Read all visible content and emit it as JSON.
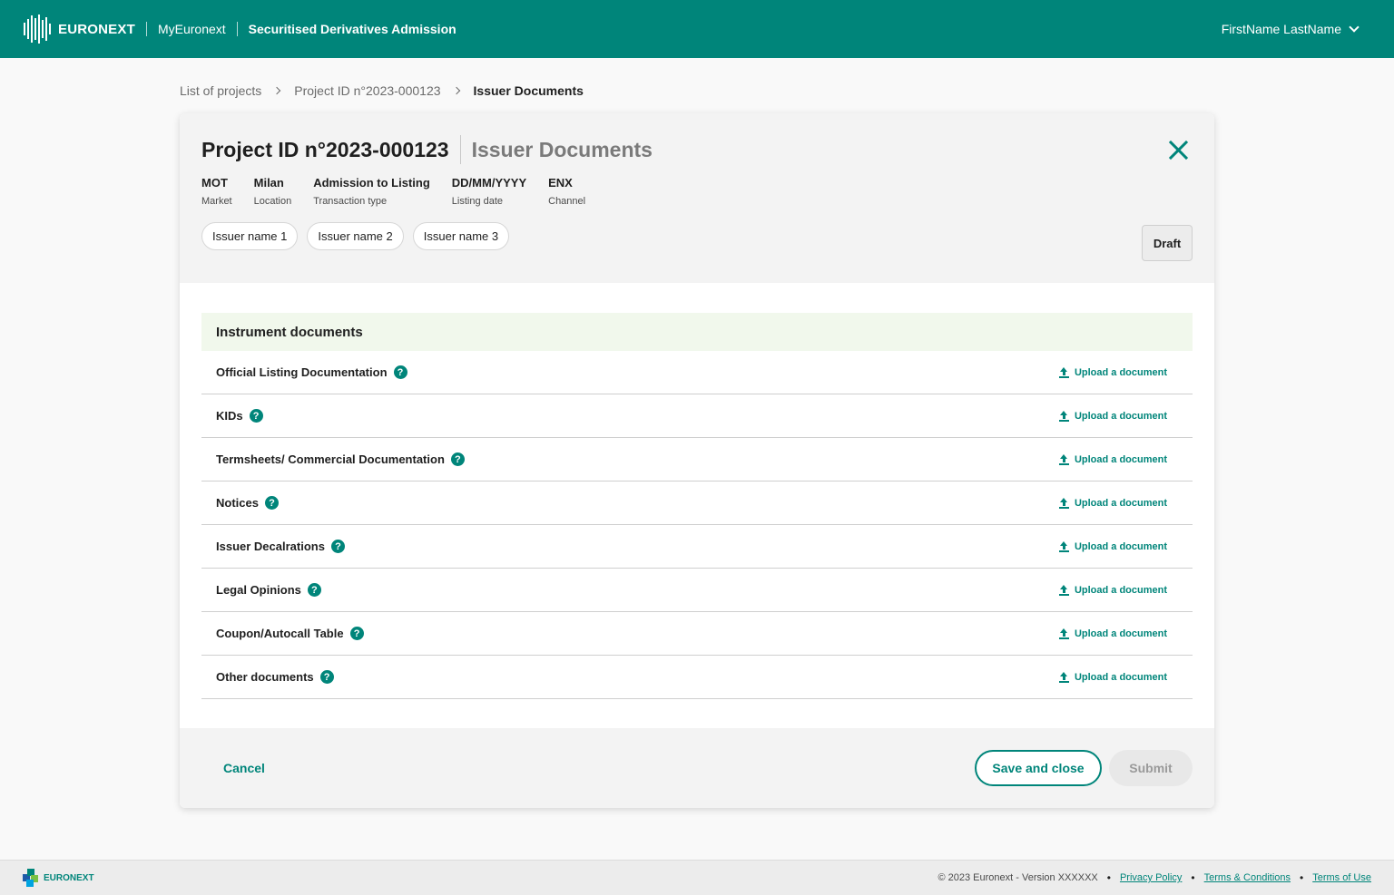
{
  "header": {
    "brand": "EURONEXT",
    "app": "MyEuronext",
    "title": "Securitised Derivatives Admission",
    "user": "FirstName LastName"
  },
  "breadcrumb": [
    "List of projects",
    "Project ID n°2023-000123",
    "Issuer Documents"
  ],
  "card": {
    "title": "Project ID n°2023-000123",
    "subtitle": "Issuer Documents",
    "meta": [
      {
        "value": "MOT",
        "label": "Market"
      },
      {
        "value": "Milan",
        "label": "Location"
      },
      {
        "value": "Admission to Listing",
        "label": "Transaction type"
      },
      {
        "value": "DD/MM/YYYY",
        "label": "Listing date"
      },
      {
        "value": "ENX",
        "label": "Channel"
      }
    ],
    "issuers": [
      "Issuer name 1",
      "Issuer name 2",
      "Issuer name 3"
    ],
    "status": "Draft",
    "section_title": "Instrument documents",
    "upload_label": "Upload a document",
    "documents": [
      "Official Listing Documentation",
      "KIDs",
      "Termsheets/ Commercial Documentation",
      "Notices",
      "Issuer Decalrations",
      "Legal Opinions",
      "Coupon/Autocall Table",
      "Other documents"
    ],
    "cancel": "Cancel",
    "save_close": "Save and close",
    "submit": "Submit"
  },
  "footer": {
    "brand": "EURONEXT",
    "copyright": "© 2023 Euronext - Version XXXXXX",
    "links": [
      "Privacy Policy",
      "Terms & Conditions",
      "Terms of Use"
    ]
  },
  "colors": {
    "primary": "#00857a",
    "section_bg": "#f1f8ec"
  }
}
